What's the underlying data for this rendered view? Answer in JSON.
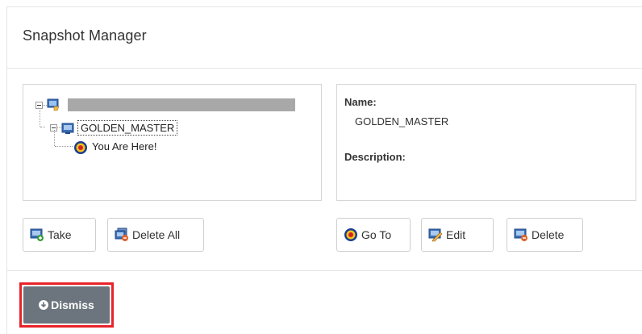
{
  "dialog": {
    "title": "Snapshot Manager"
  },
  "tree": {
    "root": {
      "label": "",
      "icon": "vm-icon",
      "redacted": true
    },
    "snapshot": {
      "label": "GOLDEN_MASTER",
      "icon": "snapshot-icon",
      "selected": true
    },
    "current": {
      "label": "You Are Here!",
      "icon": "current-state-icon"
    }
  },
  "details": {
    "name_label": "Name:",
    "name_value": "GOLDEN_MASTER",
    "description_label": "Description:",
    "description_value": ""
  },
  "buttons": {
    "take": "Take",
    "delete_all": "Delete All",
    "go_to": "Go To",
    "edit": "Edit",
    "delete": "Delete",
    "dismiss": "Dismiss"
  },
  "colors": {
    "dismiss_bg": "#6c757d",
    "highlight": "#e8232a",
    "accent_blue": "#2e5fa8"
  }
}
